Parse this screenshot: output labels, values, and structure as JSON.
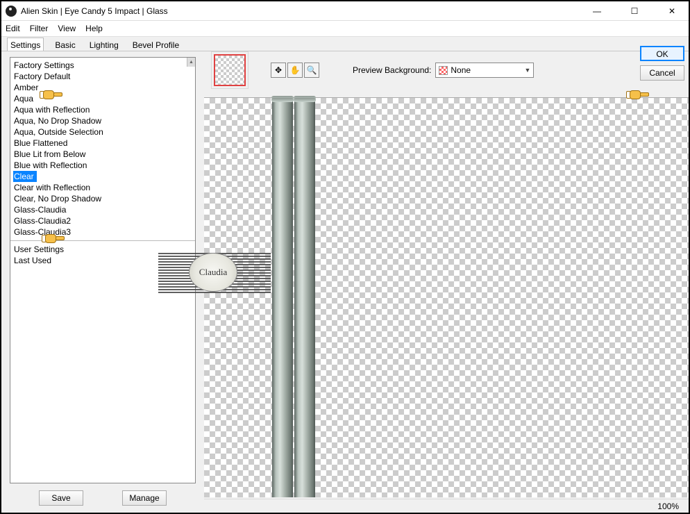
{
  "window": {
    "title": "Alien Skin | Eye Candy 5 Impact | Glass"
  },
  "menubar": [
    "Edit",
    "Filter",
    "View",
    "Help"
  ],
  "tabs": [
    "Settings",
    "Basic",
    "Lighting",
    "Bevel Profile"
  ],
  "settings_list": {
    "header": "Factory Settings",
    "items": [
      "Factory Default",
      "Amber",
      "Aqua",
      "Aqua with Reflection",
      "Aqua, No Drop Shadow",
      "Aqua, Outside Selection",
      "Blue Flattened",
      "Blue Lit from Below",
      "Blue with Reflection",
      "Clear",
      "Clear with Reflection",
      "Clear, No Drop Shadow",
      "Glass-Claudia",
      "Glass-Claudia2",
      "Glass-Claudia3"
    ],
    "selected_index": 9,
    "user_header": "User Settings",
    "user_items": [
      "Last Used"
    ]
  },
  "buttons": {
    "save": "Save",
    "manage": "Manage",
    "ok": "OK",
    "cancel": "Cancel"
  },
  "preview_bg": {
    "label": "Preview Background:",
    "value": "None"
  },
  "watermark_text": "Claudia",
  "status": {
    "zoom": "100%"
  }
}
